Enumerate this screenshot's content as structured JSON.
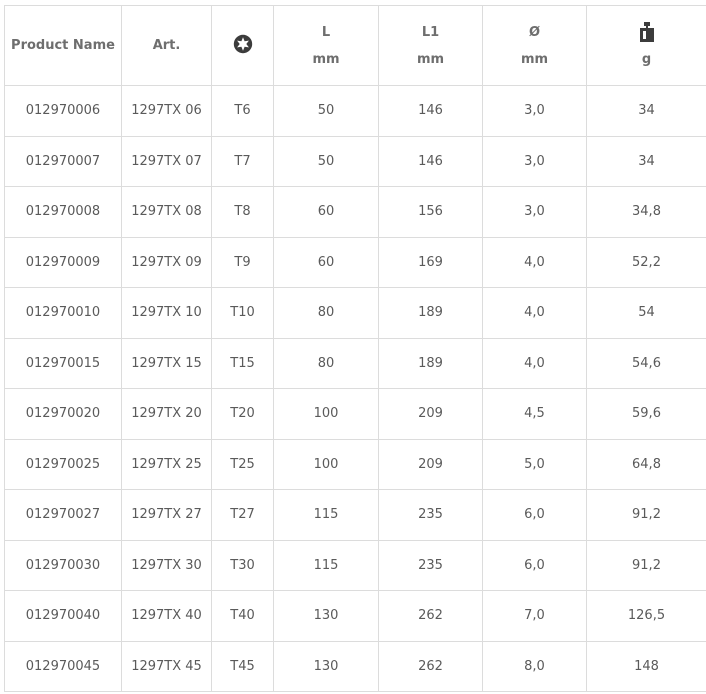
{
  "table": {
    "headers": {
      "product_name": "Product Name",
      "art": "Art.",
      "torx_icon": "torx-star-icon",
      "l_label": "L",
      "l_unit": "mm",
      "l1_label": "L1",
      "l1_unit": "mm",
      "d_label": "Ø",
      "d_unit": "mm",
      "weight_icon": "weight-icon",
      "weight_unit": "g"
    },
    "rows": [
      {
        "product": "012970006",
        "art": "1297TX 06",
        "torx": "T6",
        "l": "50",
        "l1": "146",
        "d": "3,0",
        "g": "34"
      },
      {
        "product": "012970007",
        "art": "1297TX 07",
        "torx": "T7",
        "l": "50",
        "l1": "146",
        "d": "3,0",
        "g": "34"
      },
      {
        "product": "012970008",
        "art": "1297TX 08",
        "torx": "T8",
        "l": "60",
        "l1": "156",
        "d": "3,0",
        "g": "34,8"
      },
      {
        "product": "012970009",
        "art": "1297TX 09",
        "torx": "T9",
        "l": "60",
        "l1": "169",
        "d": "4,0",
        "g": "52,2"
      },
      {
        "product": "012970010",
        "art": "1297TX 10",
        "torx": "T10",
        "l": "80",
        "l1": "189",
        "d": "4,0",
        "g": "54"
      },
      {
        "product": "012970015",
        "art": "1297TX 15",
        "torx": "T15",
        "l": "80",
        "l1": "189",
        "d": "4,0",
        "g": "54,6"
      },
      {
        "product": "012970020",
        "art": "1297TX 20",
        "torx": "T20",
        "l": "100",
        "l1": "209",
        "d": "4,5",
        "g": "59,6"
      },
      {
        "product": "012970025",
        "art": "1297TX 25",
        "torx": "T25",
        "l": "100",
        "l1": "209",
        "d": "5,0",
        "g": "64,8"
      },
      {
        "product": "012970027",
        "art": "1297TX 27",
        "torx": "T27",
        "l": "115",
        "l1": "235",
        "d": "6,0",
        "g": "91,2"
      },
      {
        "product": "012970030",
        "art": "1297TX 30",
        "torx": "T30",
        "l": "115",
        "l1": "235",
        "d": "6,0",
        "g": "91,2"
      },
      {
        "product": "012970040",
        "art": "1297TX 40",
        "torx": "T40",
        "l": "130",
        "l1": "262",
        "d": "7,0",
        "g": "126,5"
      },
      {
        "product": "012970045",
        "art": "1297TX 45",
        "torx": "T45",
        "l": "130",
        "l1": "262",
        "d": "8,0",
        "g": "148"
      }
    ]
  },
  "colors": {
    "border": "#dcdcdc",
    "header_text": "#6e6e6e",
    "cell_text": "#5a5a5a",
    "icon": "#3c3c3c"
  }
}
